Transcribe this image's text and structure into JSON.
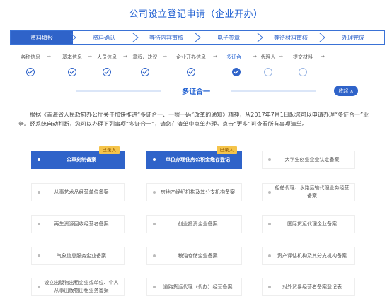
{
  "page_title": "公司设立登记申请（企业开办）",
  "tabs": [
    {
      "label": "资料填报",
      "active": true
    },
    {
      "label": "资料确认",
      "active": false
    },
    {
      "label": "等待内容审核",
      "active": false
    },
    {
      "label": "电子签章",
      "active": false
    },
    {
      "label": "等待材料审核",
      "active": false
    },
    {
      "label": "办理完成",
      "active": false
    }
  ],
  "steps": [
    {
      "label": "名称信息",
      "state": "done"
    },
    {
      "label": "基本信息",
      "state": "done"
    },
    {
      "label": "人员信息",
      "state": "done"
    },
    {
      "label": "章程、决议",
      "state": "done"
    },
    {
      "label": "企业开办信息",
      "state": "done"
    },
    {
      "label": "多证合一",
      "state": "current"
    },
    {
      "label": "代理人",
      "state": "todo"
    },
    {
      "label": "提交材料",
      "state": "todo"
    }
  ],
  "section": {
    "title": "多证合一",
    "collapse_label": "收起 ∧"
  },
  "description": "根据《青海省人民政府办公厅关于加快推进“多证合一、一照一码”改革的通知》精神，从2017年7月1日起您可以申请办理“多证合一”业务。经系统自动判断，您可以办理下列事项“多证合一”，请您在清单中点单办理。点击“更多”可查看所有事项清单。",
  "items": [
    {
      "label": "公章刻制备案",
      "selected": true,
      "badge": "已录入"
    },
    {
      "label": "单位办理住房公积金缴存登记",
      "selected": true,
      "badge": "已录入"
    },
    {
      "label": "大学生创业企业认定备案",
      "selected": false,
      "badge": ""
    },
    {
      "label": "从事艺术品经营单位备案",
      "selected": false,
      "badge": ""
    },
    {
      "label": "房地产经纪机构及其分支机构备案",
      "selected": false,
      "badge": ""
    },
    {
      "label": "船舶代理、水路运输代理业务经营备案",
      "selected": false,
      "badge": ""
    },
    {
      "label": "再生资源回收经营者备案",
      "selected": false,
      "badge": ""
    },
    {
      "label": "创业投资企业备案",
      "selected": false,
      "badge": ""
    },
    {
      "label": "国际货运代理企业备案",
      "selected": false,
      "badge": ""
    },
    {
      "label": "气象信息服务企业备案",
      "selected": false,
      "badge": ""
    },
    {
      "label": "粮油仓储企业备案",
      "selected": false,
      "badge": ""
    },
    {
      "label": "资产评估机构及其分支机构备案",
      "selected": false,
      "badge": ""
    },
    {
      "label": "设立出版物出租企业或单位、个人从事出版物出租业务备案",
      "selected": false,
      "badge": ""
    },
    {
      "label": "道路货运代理（代办）经营备案",
      "selected": false,
      "badge": ""
    },
    {
      "label": "对外贸易经营者备案登记表",
      "selected": false,
      "badge": ""
    }
  ],
  "colors": {
    "primary": "#2f63c9",
    "badge": "#f5c44a",
    "title": "#1f5fd1"
  }
}
